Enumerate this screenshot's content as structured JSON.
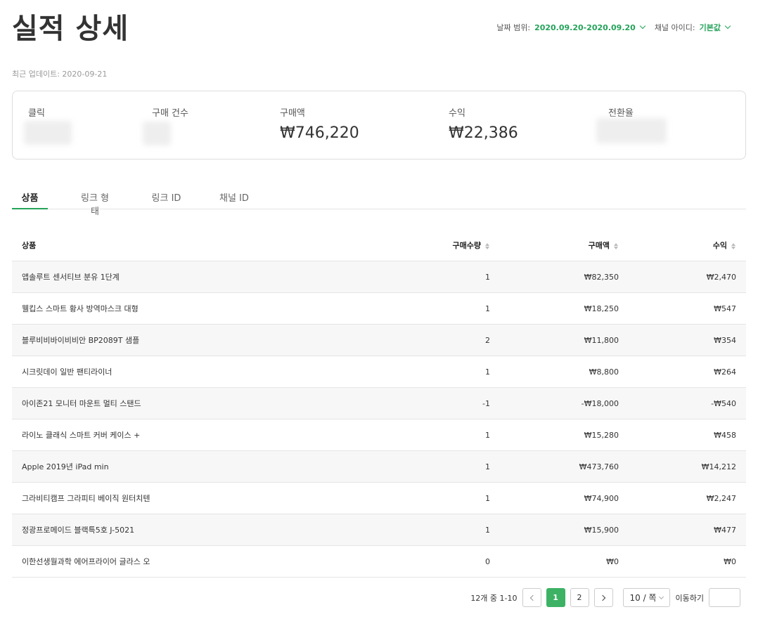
{
  "header": {
    "title": "실적 상세",
    "date_label": "날짜 범위:",
    "date_value": "2020.09.20-2020.09.20",
    "channel_label": "채널 아이디:",
    "channel_value": "기본값"
  },
  "updated": "최근 업데이트: 2020-09-21",
  "summary": {
    "clicks_label": "클릭",
    "orders_label": "구매 건수",
    "sales_label": "구매액",
    "sales_value": "₩746,220",
    "revenue_label": "수익",
    "revenue_value": "₩22,386",
    "conversion_label": "전환율"
  },
  "tabs": [
    "상품",
    "링크 형태",
    "링크 ID",
    "채널 ID"
  ],
  "table": {
    "headers": [
      "상품",
      "구매수량",
      "구매액",
      "수익"
    ],
    "rows": [
      [
        "앱솔루트 센서티브 분유 1단계",
        "1",
        "₩82,350",
        "₩2,470"
      ],
      [
        "웰킵스 스마트 황사 방역마스크 대형",
        "1",
        "₩18,250",
        "₩547"
      ],
      [
        "블루비비바이비비안 BP2089T 샘플",
        "2",
        "₩11,800",
        "₩354"
      ],
      [
        "시크릿데이 일반 팬티라이너",
        "1",
        "₩8,800",
        "₩264"
      ],
      [
        "아이존21 모니터 마운트 멀티 스탠드",
        "-1",
        "-₩18,000",
        "-₩540"
      ],
      [
        "라이노 클래식 스마트 커버 케이스 +",
        "1",
        "₩15,280",
        "₩458"
      ],
      [
        "Apple 2019년 iPad min",
        "1",
        "₩473,760",
        "₩14,212"
      ],
      [
        "그라비티캠프 그라피티 베이직 원터치텐",
        "1",
        "₩74,900",
        "₩2,247"
      ],
      [
        "정광프로메이드 블랙특5호 J-5021",
        "1",
        "₩15,900",
        "₩477"
      ],
      [
        "이한선생월과학 에어프라이어 글라스 오",
        "0",
        "₩0",
        "₩0"
      ]
    ]
  },
  "pagination": {
    "info": "12개 중 1-10",
    "pages": [
      "1",
      "2"
    ],
    "page_size": "10 / 쪽",
    "goto_label": "이동하기"
  },
  "colors": {
    "accent": "#24a35a",
    "active_page": "#3db264"
  }
}
